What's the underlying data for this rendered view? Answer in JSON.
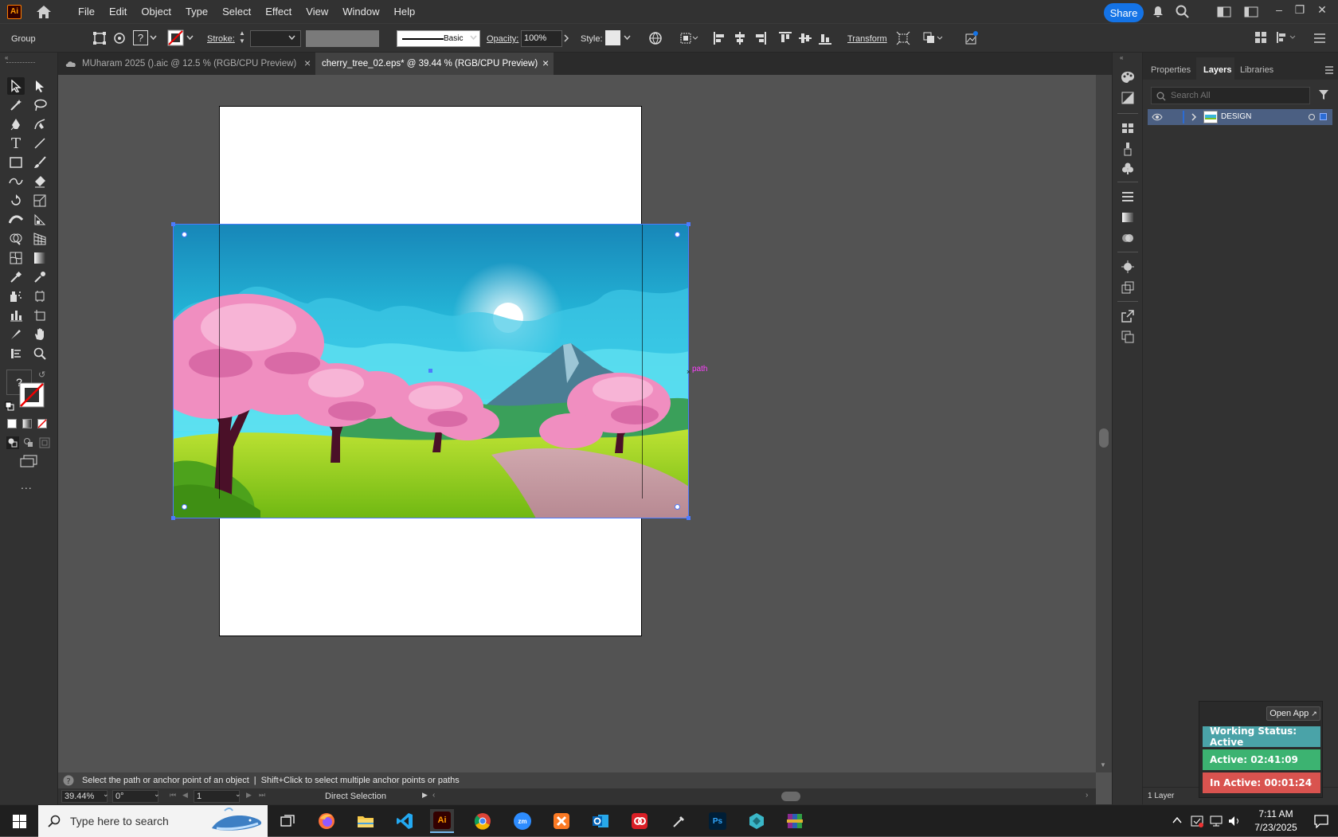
{
  "app": {
    "logo_text": "Ai",
    "menu": [
      "File",
      "Edit",
      "Object",
      "Type",
      "Select",
      "Effect",
      "View",
      "Window",
      "Help"
    ],
    "share_label": "Share"
  },
  "control_bar": {
    "selection_label": "Group",
    "fill_label": "?",
    "stroke_label": "Stroke:",
    "stroke_style": "Basic",
    "opacity_label": "Opacity:",
    "opacity_value": "100%",
    "style_label": "Style:",
    "transform_label": "Transform"
  },
  "tabs": [
    {
      "label": "MUharam 2025 ().aic @ 12.5 % (RGB/CPU Preview)",
      "active": false
    },
    {
      "label": "cherry_tree_02.eps* @ 39.44 % (RGB/CPU Preview)",
      "active": true
    }
  ],
  "canvas": {
    "path_hint": "path"
  },
  "toolbar": {
    "unknown_fill": "?",
    "more": "..."
  },
  "panel": {
    "tabs": [
      "Properties",
      "Layers",
      "Libraries"
    ],
    "active_tab": "Layers",
    "search_placeholder": "Search All",
    "layers": [
      {
        "name": "DESIGN"
      }
    ],
    "footer_count": "1 Layer"
  },
  "status": {
    "message_part1": "Select the path or anchor point of an object",
    "message_sep": "|",
    "message_part2": "Shift+Click to select multiple anchor points or paths",
    "zoom": "39.44%",
    "rotation": "0°",
    "artboard": "1",
    "tool": "Direct Selection"
  },
  "widget": {
    "open_app": "Open App",
    "working_status": "Working Status: Active",
    "active_time": "Active: 02:41:09",
    "inactive_time": "In Active: 00:01:24",
    "colors": {
      "status": "#4aa3a8",
      "active": "#3cb371",
      "inactive": "#d9534f"
    }
  },
  "taskbar": {
    "search_placeholder": "Type here to search",
    "time": "7:11 AM",
    "date": "7/23/2025",
    "apps": [
      "firefox-icon",
      "file-explorer-icon",
      "vscode-icon",
      "illustrator-icon",
      "chrome-icon",
      "zoom-icon",
      "xampp-icon",
      "outlook-icon",
      "creative-cloud-icon",
      "pen-icon",
      "photoshop-icon",
      "dev-icon",
      "winrar-icon"
    ]
  }
}
